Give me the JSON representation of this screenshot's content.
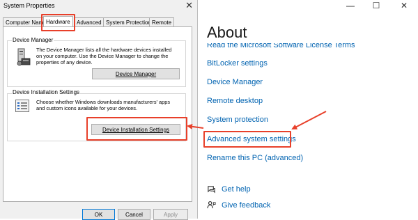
{
  "dialog": {
    "title": "System Properties",
    "close_glyph": "✕",
    "tabs": [
      {
        "label": "Computer Name"
      },
      {
        "label": "Hardware"
      },
      {
        "label": "Advanced"
      },
      {
        "label": "System Protection"
      },
      {
        "label": "Remote"
      }
    ],
    "device_manager": {
      "title": "Device Manager",
      "description_lines": [
        "The Device Manager lists all the hardware devices installed",
        "on your computer. Use the Device Manager to change the",
        "properties of any device."
      ],
      "button": "Device Manager"
    },
    "install_settings": {
      "title": "Device Installation Settings",
      "description_lines": [
        "Choose whether Windows downloads manufacturers' apps",
        "and custom icons available for your devices."
      ],
      "button": "Device Installation Settings"
    },
    "footer": {
      "ok": "OK",
      "cancel": "Cancel",
      "apply": "Apply"
    }
  },
  "settings": {
    "title": "About",
    "window_controls": {
      "minimize": "—",
      "maximize": "☐",
      "close": "✕"
    },
    "links": [
      "Read the Microsoft Software License Terms",
      "BitLocker settings",
      "Device Manager",
      "Remote desktop",
      "System protection",
      "Advanced system settings",
      "Rename this PC (advanced)"
    ],
    "help": [
      {
        "label": "Get help",
        "icon": "get-help-icon"
      },
      {
        "label": "Give feedback",
        "icon": "feedback-icon"
      }
    ]
  },
  "colors": {
    "link": "#0063b1",
    "highlight": "#e8402a",
    "dialog_bg": "#f0f0f0"
  }
}
